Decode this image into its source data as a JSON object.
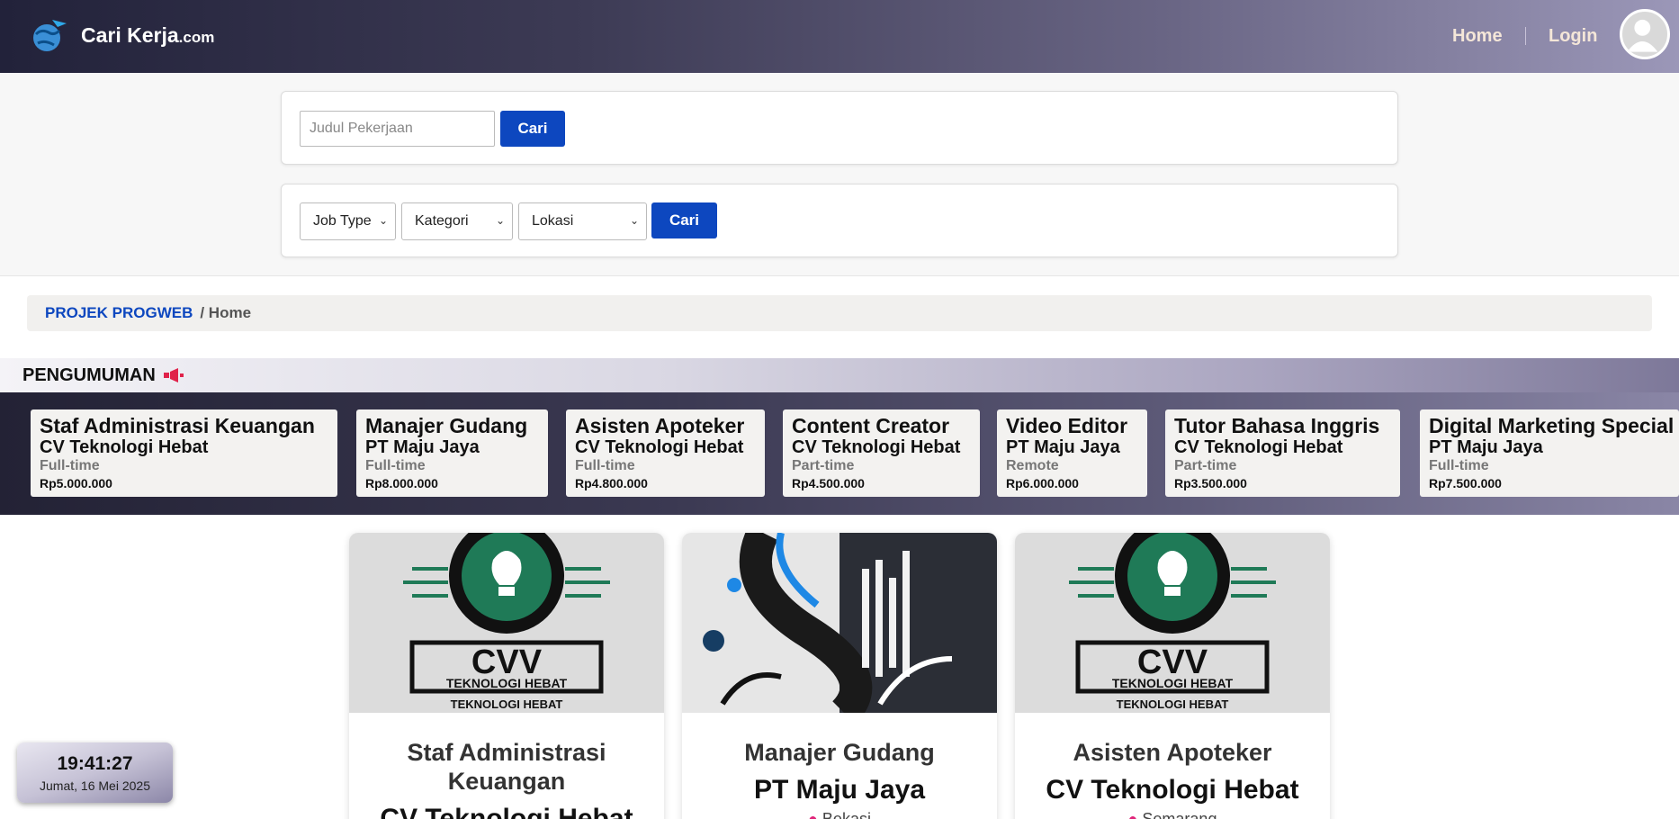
{
  "header": {
    "brand_main": "Cari Kerja",
    "brand_suffix": ".com",
    "nav_home": "Home",
    "nav_login": "Login"
  },
  "search": {
    "placeholder": "Judul Pekerjaan",
    "button_label": "Cari"
  },
  "filters": {
    "job_type": "Job Type",
    "kategori": "Kategori",
    "lokasi": "Lokasi",
    "button_label": "Cari"
  },
  "breadcrumb": {
    "root": "PROJEK PROGWEB",
    "current": "/ Home"
  },
  "announcement": {
    "title": "PENGUMUMAN",
    "items": [
      {
        "title": "Staf Administrasi Keuangan",
        "company": "CV Teknologi Hebat",
        "type": "Full-time",
        "salary": "Rp5.000.000"
      },
      {
        "title": "Manajer Gudang",
        "company": "PT Maju Jaya",
        "type": "Full-time",
        "salary": "Rp8.000.000"
      },
      {
        "title": "Asisten Apoteker",
        "company": "CV Teknologi Hebat",
        "type": "Full-time",
        "salary": "Rp4.800.000"
      },
      {
        "title": "Content Creator",
        "company": "CV Teknologi Hebat",
        "type": "Part-time",
        "salary": "Rp4.500.000"
      },
      {
        "title": "Video Editor",
        "company": "PT Maju Jaya",
        "type": "Remote",
        "salary": "Rp6.000.000"
      },
      {
        "title": "Tutor Bahasa Inggris",
        "company": "CV Teknologi Hebat",
        "type": "Part-time",
        "salary": "Rp3.500.000"
      },
      {
        "title": "Digital Marketing Special",
        "company": "PT Maju Jaya",
        "type": "Full-time",
        "salary": "Rp7.500.000"
      }
    ]
  },
  "jobs": [
    {
      "title": "Staf Administrasi Keuangan",
      "company": "CV Teknologi Hebat",
      "location": "",
      "logo_text": "CVV",
      "logo_sub": "TEKNOLOGI HEBAT"
    },
    {
      "title": "Manajer Gudang",
      "company": "PT Maju Jaya",
      "location": "Bekasi",
      "logo_text": "",
      "logo_sub": ""
    },
    {
      "title": "Asisten Apoteker",
      "company": "CV Teknologi Hebat",
      "location": "Semarang",
      "logo_text": "CVV",
      "logo_sub": "TEKNOLOGI HEBAT"
    }
  ],
  "clock": {
    "time": "19:41:27",
    "date": "Jumat, 16 Mei 2025"
  },
  "colors": {
    "accent": "#0d47bf",
    "header_dark": "#22223a",
    "header_light": "#9b97b8"
  }
}
